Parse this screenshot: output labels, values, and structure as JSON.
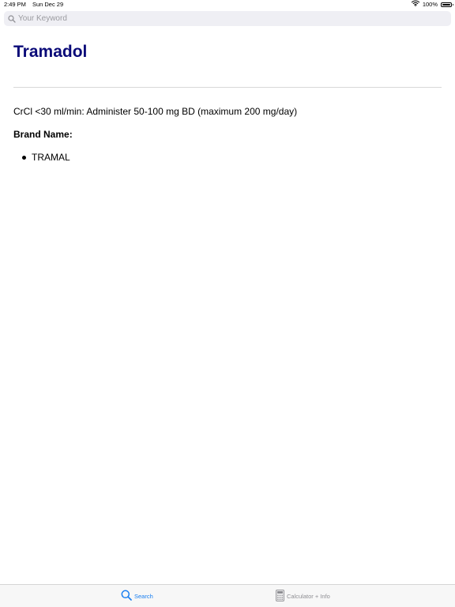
{
  "status_bar": {
    "time": "2:49 PM",
    "date": "Sun Dec 29",
    "battery_percent": "100%",
    "battery_level": 1.0,
    "wifi_icon": "wifi-icon",
    "battery_icon": "battery-icon"
  },
  "search": {
    "placeholder": "Your Keyword",
    "value": "",
    "icon": "search-icon"
  },
  "drug": {
    "title": "Tramadol",
    "dosage": "CrCl <30 ml/min: Administer 50-100 mg BD (maximum 200 mg/day)",
    "brand_heading": "Brand Name:",
    "brands": [
      "TRAMAL"
    ]
  },
  "tab_bar": {
    "tabs": [
      {
        "label": "Search",
        "icon": "search-icon",
        "selected": true
      },
      {
        "label": "Calculator + Info",
        "icon": "calculator-icon",
        "selected": false
      }
    ]
  },
  "colors": {
    "title": "#0a0a78",
    "accent": "#1a7ff0",
    "inactive": "#8e8e93",
    "search_bg": "#efeff4"
  }
}
